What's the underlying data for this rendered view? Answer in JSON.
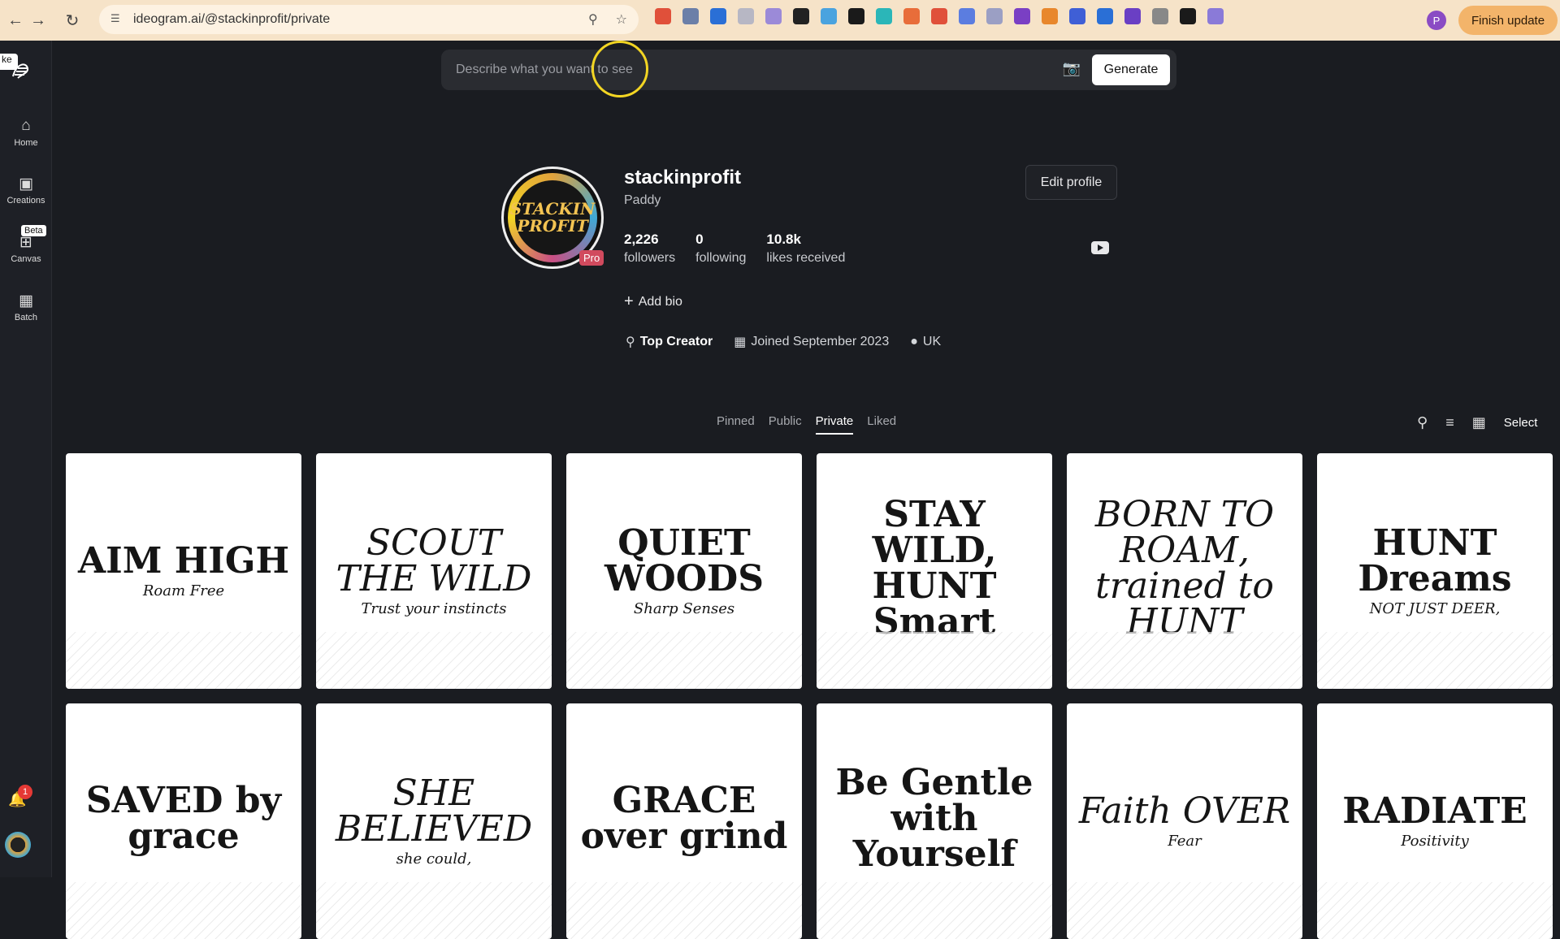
{
  "browser": {
    "url": "ideogram.ai/@stackinprofit/private",
    "finish_update": "Finish update",
    "profile_initial": "P",
    "extensions": [
      {
        "icon": "red-stack-icon",
        "color": "#e0503a"
      },
      {
        "icon": "fb-icon",
        "color": "#6b7fa8"
      },
      {
        "icon": "blue-circle-icon",
        "color": "#2a6fd6"
      },
      {
        "icon": "k-icon",
        "color": "#b7b7c4"
      },
      {
        "icon": "pen-icon",
        "color": "#9b8ad8"
      },
      {
        "icon": "pen-black-icon",
        "color": "#222222"
      },
      {
        "icon": "frame-icon",
        "color": "#4aa3df"
      },
      {
        "icon": "play-icon",
        "color": "#1a1a1a"
      },
      {
        "icon": "m-circle-icon",
        "color": "#2bb6b8"
      },
      {
        "icon": "color-wheel-icon",
        "color": "#e86d3a"
      },
      {
        "icon": "brush-icon",
        "color": "#e0503a"
      },
      {
        "icon": "link-icon",
        "color": "#5b7de0"
      },
      {
        "icon": "code-icon",
        "color": "#9b9fc4"
      },
      {
        "icon": "eye-icon",
        "color": "#7a3fc4"
      },
      {
        "icon": "fox-icon",
        "color": "#e8872c"
      },
      {
        "icon": "layers-icon",
        "color": "#3f5fd6"
      },
      {
        "icon": "bolt-icon",
        "color": "#2a6fd6"
      },
      {
        "icon": "t-circle-icon",
        "color": "#6a3fc4"
      },
      {
        "icon": "grid-icon",
        "color": "#888888"
      },
      {
        "icon": "m-bold-icon",
        "color": "#1a1a1a"
      },
      {
        "icon": "swirl-icon",
        "color": "#8a7ad8"
      }
    ]
  },
  "sidebar": {
    "logo_tab": "ke",
    "items": [
      {
        "label": "Home",
        "icon": "home-icon"
      },
      {
        "label": "Creations",
        "icon": "image-icon"
      },
      {
        "label": "Canvas",
        "icon": "canvas-icon",
        "badge": "Beta"
      },
      {
        "label": "Batch",
        "icon": "table-icon"
      }
    ],
    "notification_count": "1"
  },
  "prompt": {
    "placeholder": "Describe what you want to see",
    "generate": "Generate"
  },
  "profile": {
    "username": "stackinprofit",
    "display_name": "Paddy",
    "avatar_text": "STACKIN PROFIT",
    "pro_badge": "Pro",
    "edit_profile": "Edit profile",
    "stats": [
      {
        "value": "2,226",
        "label": "followers"
      },
      {
        "value": "0",
        "label": "following"
      },
      {
        "value": "10.8k",
        "label": "likes received"
      }
    ],
    "add_bio": "Add bio",
    "badge": "Top Creator",
    "joined": "Joined September 2023",
    "location": "UK"
  },
  "tabs": [
    "Pinned",
    "Public",
    "Private",
    "Liked"
  ],
  "active_tab": "Private",
  "tools": {
    "select": "Select"
  },
  "grid": [
    {
      "title": "AIM HIGH",
      "subtitle": "Roam Free"
    },
    {
      "title": "SCOUT THE WILD",
      "subtitle": "Trust your instincts"
    },
    {
      "title": "QUIET WOODS",
      "subtitle": "Sharp Senses"
    },
    {
      "title": "STAY WILD, HUNT Smart",
      "subtitle": ""
    },
    {
      "title": "BORN TO ROAM, trained to HUNT",
      "subtitle": ""
    },
    {
      "title": "HUNT Dreams",
      "subtitle": "NOT JUST DEER,"
    },
    {
      "title": "SAVED by grace",
      "subtitle": ""
    },
    {
      "title": "SHE BELIEVED",
      "subtitle": "she could,"
    },
    {
      "title": "GRACE over grind",
      "subtitle": ""
    },
    {
      "title": "Be Gentle with Yourself",
      "subtitle": ""
    },
    {
      "title": "Faith OVER",
      "subtitle": "Fear"
    },
    {
      "title": "RADIATE",
      "subtitle": "Positivity"
    }
  ]
}
